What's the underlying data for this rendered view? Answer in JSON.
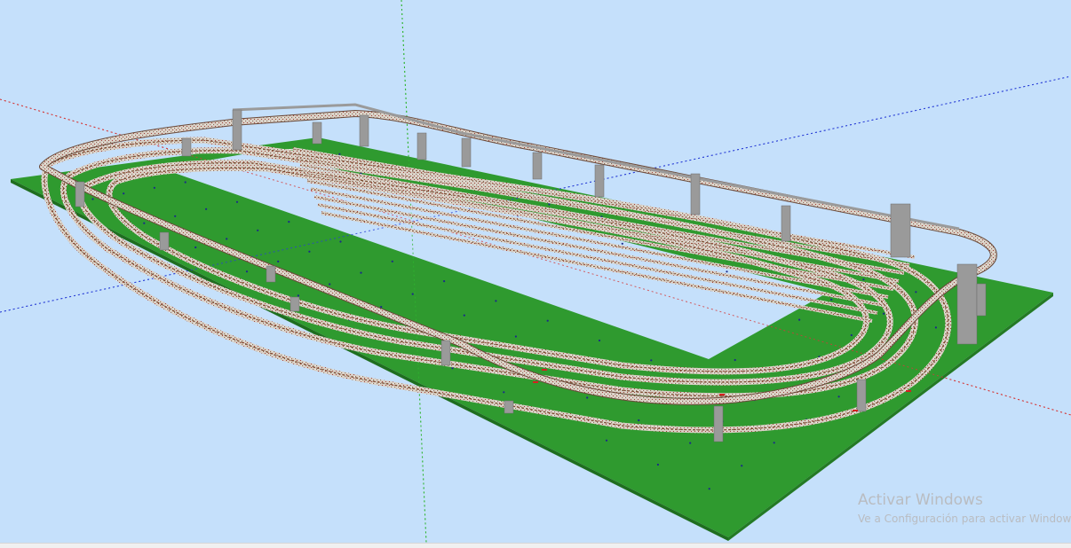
{
  "viewport": {
    "background": "#c5e0fb",
    "axes": {
      "red": "#d43a3a",
      "green": "#2fb52f",
      "blue": "#2a3fd6"
    }
  },
  "model": {
    "baseboard_color": "#2f9a2f",
    "baseboard_edge_color": "#1f6e1f",
    "opening_color": "#c5e0fb",
    "ballast_color": "#d8cfc4",
    "rail_color": "#7a4a2e",
    "pillar_color": "#9a9a9a",
    "dot_color": "#1a2a8a",
    "icons": [
      "track-layout",
      "support-pillar",
      "baseboard"
    ]
  },
  "watermark": {
    "title": "Activar Windows",
    "subtitle": "Ve a Configuración para activar Windows."
  }
}
